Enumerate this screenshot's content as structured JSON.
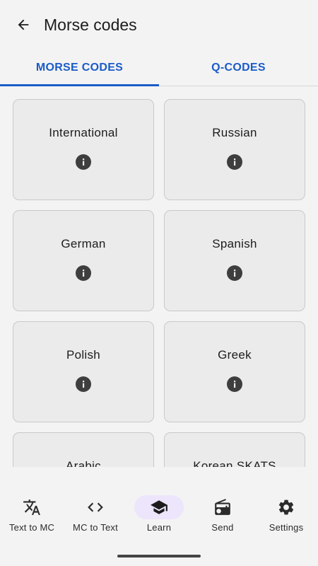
{
  "header": {
    "title": "Morse codes",
    "back_icon": "arrow-back-icon"
  },
  "tabs": [
    {
      "label": "MORSE CODES",
      "active": true
    },
    {
      "label": "Q-CODES",
      "active": false
    }
  ],
  "cards": [
    {
      "label": "International"
    },
    {
      "label": "Russian"
    },
    {
      "label": "German"
    },
    {
      "label": "Spanish"
    },
    {
      "label": "Polish"
    },
    {
      "label": "Greek"
    },
    {
      "label": "Arabic"
    },
    {
      "label": "Korean SKATS"
    }
  ],
  "bottom_nav": [
    {
      "label": "Text to MC",
      "icon": "translate-icon",
      "active": false
    },
    {
      "label": "MC to Text",
      "icon": "code-icon",
      "active": false
    },
    {
      "label": "Learn",
      "icon": "school-icon",
      "active": true
    },
    {
      "label": "Send",
      "icon": "radio-icon",
      "active": false
    },
    {
      "label": "Settings",
      "icon": "gear-icon",
      "active": false
    }
  ],
  "colors": {
    "accent": "#1a5cc8",
    "background": "#f3f3f3",
    "card": "#ebebeb",
    "nav_active": "#ece5fb"
  }
}
